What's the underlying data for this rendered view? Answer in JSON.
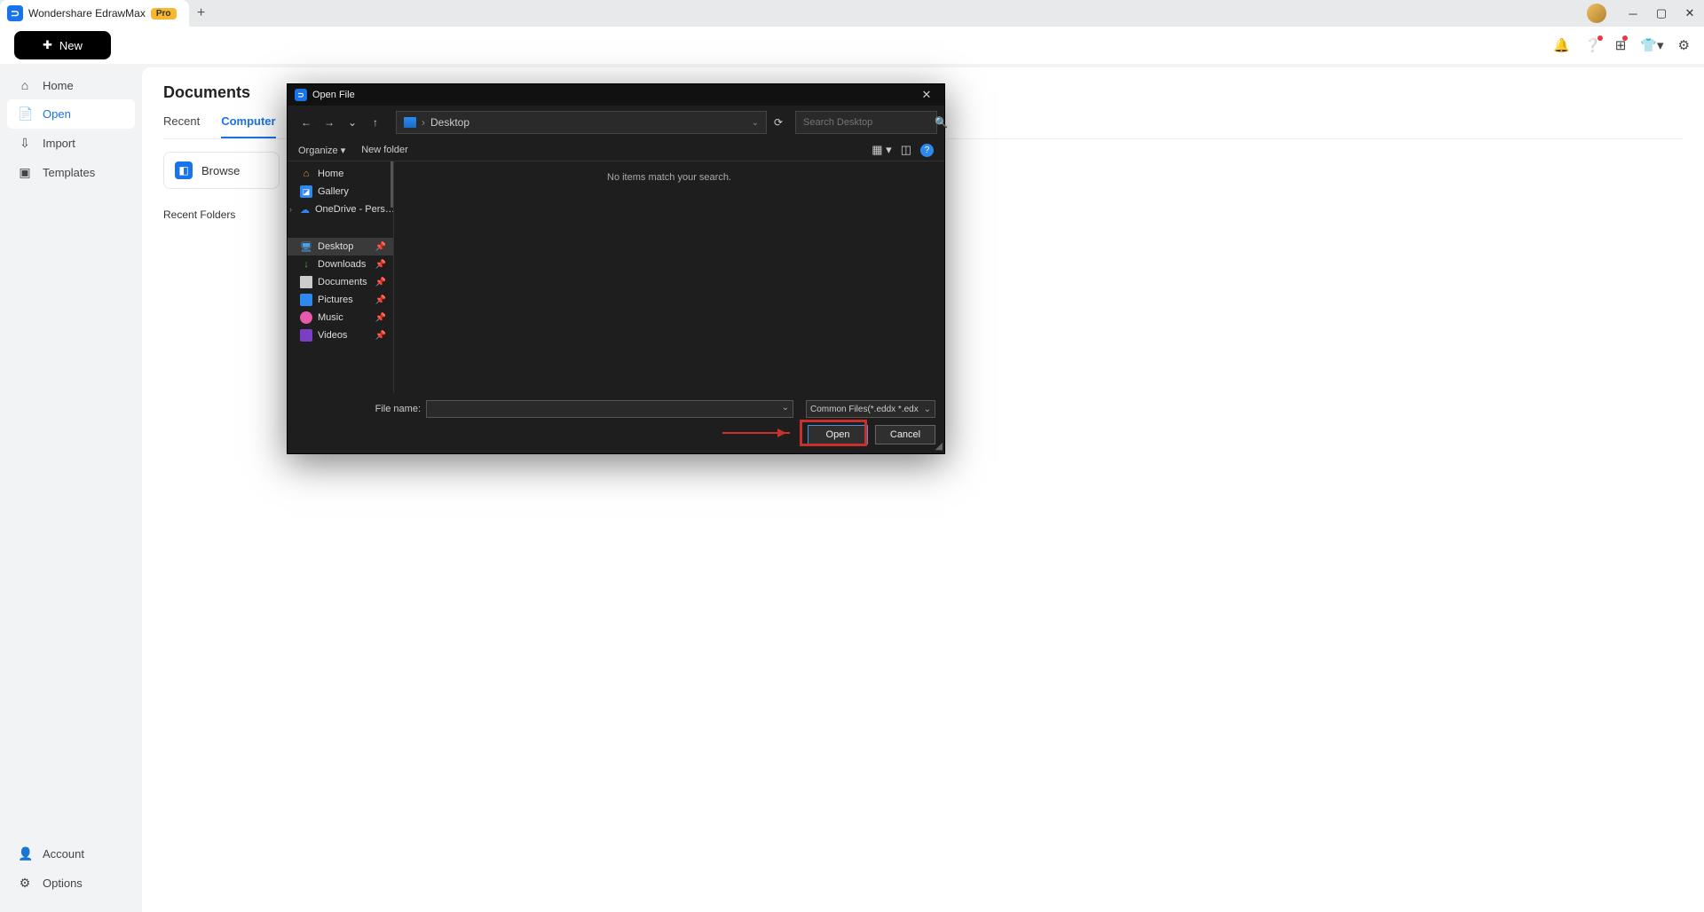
{
  "titlebar": {
    "app_name": "Wondershare EdrawMax",
    "badge": "Pro"
  },
  "topbar": {
    "new_label": "New"
  },
  "sidebar": {
    "items": [
      {
        "icon": "⌂",
        "label": "Home"
      },
      {
        "icon": "📄",
        "label": "Open"
      },
      {
        "icon": "⇩",
        "label": "Import"
      },
      {
        "icon": "▣",
        "label": "Templates"
      }
    ],
    "bottom": [
      {
        "icon": "👤",
        "label": "Account"
      },
      {
        "icon": "⚙",
        "label": "Options"
      }
    ]
  },
  "main": {
    "title": "Documents",
    "tabs": [
      {
        "label": "Recent"
      },
      {
        "label": "Computer"
      }
    ],
    "browse": "Browse",
    "recent_folders": "Recent Folders"
  },
  "dialog": {
    "title": "Open File",
    "path": "Desktop",
    "search_placeholder": "Search Desktop",
    "organize": "Organize",
    "newfolder": "New folder",
    "empty": "No items match your search.",
    "nav": [
      {
        "label": "Home"
      },
      {
        "label": "Gallery"
      },
      {
        "label": "OneDrive - Pers…"
      },
      {
        "label": "Desktop"
      },
      {
        "label": "Downloads"
      },
      {
        "label": "Documents"
      },
      {
        "label": "Pictures"
      },
      {
        "label": "Music"
      },
      {
        "label": "Videos"
      }
    ],
    "fname_label": "File name:",
    "ftype": "Common Files(*.eddx *.edx *.vs",
    "open": "Open",
    "cancel": "Cancel"
  }
}
